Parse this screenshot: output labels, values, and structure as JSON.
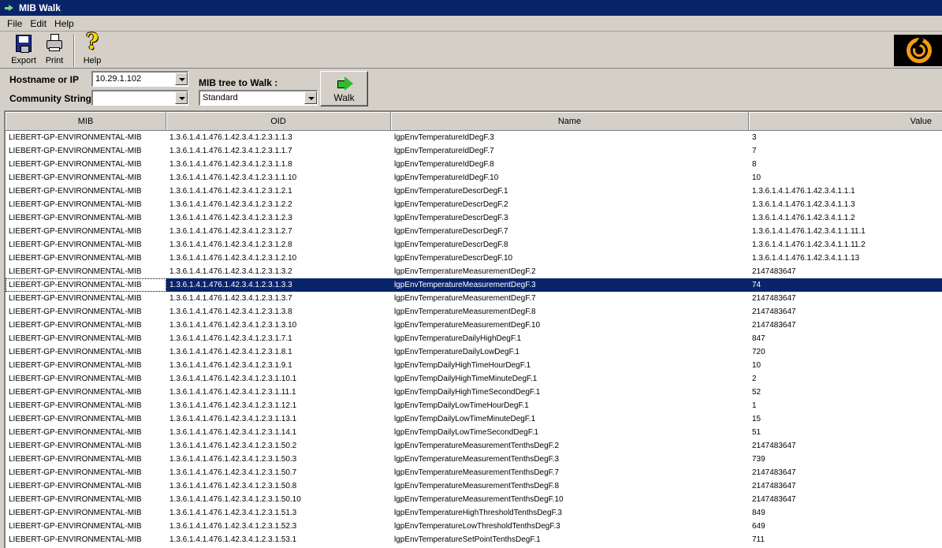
{
  "window": {
    "title": "MIB Walk"
  },
  "menu": [
    "File",
    "Edit",
    "Help"
  ],
  "toolbar": {
    "export_label": "Export",
    "print_label": "Print",
    "help_label": "Help"
  },
  "form": {
    "host_label": "Hostname or IP",
    "host_value": "10.29.1.102",
    "community_label": "Community String",
    "community_value": "",
    "tree_label": "MIB tree to Walk :",
    "tree_value": "Standard",
    "walk_label": "Walk"
  },
  "table": {
    "columns": [
      "MIB",
      "OID",
      "Name",
      "Value"
    ],
    "selected_index": 11,
    "rows": [
      [
        "LIEBERT-GP-ENVIRONMENTAL-MIB",
        "1.3.6.1.4.1.476.1.42.3.4.1.2.3.1.1.3",
        "lgpEnvTemperatureIdDegF.3",
        "3"
      ],
      [
        "LIEBERT-GP-ENVIRONMENTAL-MIB",
        "1.3.6.1.4.1.476.1.42.3.4.1.2.3.1.1.7",
        "lgpEnvTemperatureIdDegF.7",
        "7"
      ],
      [
        "LIEBERT-GP-ENVIRONMENTAL-MIB",
        "1.3.6.1.4.1.476.1.42.3.4.1.2.3.1.1.8",
        "lgpEnvTemperatureIdDegF.8",
        "8"
      ],
      [
        "LIEBERT-GP-ENVIRONMENTAL-MIB",
        "1.3.6.1.4.1.476.1.42.3.4.1.2.3.1.1.10",
        "lgpEnvTemperatureIdDegF.10",
        "10"
      ],
      [
        "LIEBERT-GP-ENVIRONMENTAL-MIB",
        "1.3.6.1.4.1.476.1.42.3.4.1.2.3.1.2.1",
        "lgpEnvTemperatureDescrDegF.1",
        "1.3.6.1.4.1.476.1.42.3.4.1.1.1"
      ],
      [
        "LIEBERT-GP-ENVIRONMENTAL-MIB",
        "1.3.6.1.4.1.476.1.42.3.4.1.2.3.1.2.2",
        "lgpEnvTemperatureDescrDegF.2",
        "1.3.6.1.4.1.476.1.42.3.4.1.1.3"
      ],
      [
        "LIEBERT-GP-ENVIRONMENTAL-MIB",
        "1.3.6.1.4.1.476.1.42.3.4.1.2.3.1.2.3",
        "lgpEnvTemperatureDescrDegF.3",
        "1.3.6.1.4.1.476.1.42.3.4.1.1.2"
      ],
      [
        "LIEBERT-GP-ENVIRONMENTAL-MIB",
        "1.3.6.1.4.1.476.1.42.3.4.1.2.3.1.2.7",
        "lgpEnvTemperatureDescrDegF.7",
        "1.3.6.1.4.1.476.1.42.3.4.1.1.11.1"
      ],
      [
        "LIEBERT-GP-ENVIRONMENTAL-MIB",
        "1.3.6.1.4.1.476.1.42.3.4.1.2.3.1.2.8",
        "lgpEnvTemperatureDescrDegF.8",
        "1.3.6.1.4.1.476.1.42.3.4.1.1.11.2"
      ],
      [
        "LIEBERT-GP-ENVIRONMENTAL-MIB",
        "1.3.6.1.4.1.476.1.42.3.4.1.2.3.1.2.10",
        "lgpEnvTemperatureDescrDegF.10",
        "1.3.6.1.4.1.476.1.42.3.4.1.1.13"
      ],
      [
        "LIEBERT-GP-ENVIRONMENTAL-MIB",
        "1.3.6.1.4.1.476.1.42.3.4.1.2.3.1.3.2",
        "lgpEnvTemperatureMeasurementDegF.2",
        "2147483647"
      ],
      [
        "LIEBERT-GP-ENVIRONMENTAL-MIB",
        "1.3.6.1.4.1.476.1.42.3.4.1.2.3.1.3.3",
        "lgpEnvTemperatureMeasurementDegF.3",
        "74"
      ],
      [
        "LIEBERT-GP-ENVIRONMENTAL-MIB",
        "1.3.6.1.4.1.476.1.42.3.4.1.2.3.1.3.7",
        "lgpEnvTemperatureMeasurementDegF.7",
        "2147483647"
      ],
      [
        "LIEBERT-GP-ENVIRONMENTAL-MIB",
        "1.3.6.1.4.1.476.1.42.3.4.1.2.3.1.3.8",
        "lgpEnvTemperatureMeasurementDegF.8",
        "2147483647"
      ],
      [
        "LIEBERT-GP-ENVIRONMENTAL-MIB",
        "1.3.6.1.4.1.476.1.42.3.4.1.2.3.1.3.10",
        "lgpEnvTemperatureMeasurementDegF.10",
        "2147483647"
      ],
      [
        "LIEBERT-GP-ENVIRONMENTAL-MIB",
        "1.3.6.1.4.1.476.1.42.3.4.1.2.3.1.7.1",
        "lgpEnvTemperatureDailyHighDegF.1",
        "847"
      ],
      [
        "LIEBERT-GP-ENVIRONMENTAL-MIB",
        "1.3.6.1.4.1.476.1.42.3.4.1.2.3.1.8.1",
        "lgpEnvTemperatureDailyLowDegF.1",
        "720"
      ],
      [
        "LIEBERT-GP-ENVIRONMENTAL-MIB",
        "1.3.6.1.4.1.476.1.42.3.4.1.2.3.1.9.1",
        "lgpEnvTempDailyHighTimeHourDegF.1",
        "10"
      ],
      [
        "LIEBERT-GP-ENVIRONMENTAL-MIB",
        "1.3.6.1.4.1.476.1.42.3.4.1.2.3.1.10.1",
        "lgpEnvTempDailyHighTimeMinuteDegF.1",
        "2"
      ],
      [
        "LIEBERT-GP-ENVIRONMENTAL-MIB",
        "1.3.6.1.4.1.476.1.42.3.4.1.2.3.1.11.1",
        "lgpEnvTempDailyHighTimeSecondDegF.1",
        "52"
      ],
      [
        "LIEBERT-GP-ENVIRONMENTAL-MIB",
        "1.3.6.1.4.1.476.1.42.3.4.1.2.3.1.12.1",
        "lgpEnvTempDailyLowTimeHourDegF.1",
        "1"
      ],
      [
        "LIEBERT-GP-ENVIRONMENTAL-MIB",
        "1.3.6.1.4.1.476.1.42.3.4.1.2.3.1.13.1",
        "lgpEnvTempDailyLowTimeMinuteDegF.1",
        "15"
      ],
      [
        "LIEBERT-GP-ENVIRONMENTAL-MIB",
        "1.3.6.1.4.1.476.1.42.3.4.1.2.3.1.14.1",
        "lgpEnvTempDailyLowTimeSecondDegF.1",
        "51"
      ],
      [
        "LIEBERT-GP-ENVIRONMENTAL-MIB",
        "1.3.6.1.4.1.476.1.42.3.4.1.2.3.1.50.2",
        "lgpEnvTemperatureMeasurementTenthsDegF.2",
        "2147483647"
      ],
      [
        "LIEBERT-GP-ENVIRONMENTAL-MIB",
        "1.3.6.1.4.1.476.1.42.3.4.1.2.3.1.50.3",
        "lgpEnvTemperatureMeasurementTenthsDegF.3",
        "739"
      ],
      [
        "LIEBERT-GP-ENVIRONMENTAL-MIB",
        "1.3.6.1.4.1.476.1.42.3.4.1.2.3.1.50.7",
        "lgpEnvTemperatureMeasurementTenthsDegF.7",
        "2147483647"
      ],
      [
        "LIEBERT-GP-ENVIRONMENTAL-MIB",
        "1.3.6.1.4.1.476.1.42.3.4.1.2.3.1.50.8",
        "lgpEnvTemperatureMeasurementTenthsDegF.8",
        "2147483647"
      ],
      [
        "LIEBERT-GP-ENVIRONMENTAL-MIB",
        "1.3.6.1.4.1.476.1.42.3.4.1.2.3.1.50.10",
        "lgpEnvTemperatureMeasurementTenthsDegF.10",
        "2147483647"
      ],
      [
        "LIEBERT-GP-ENVIRONMENTAL-MIB",
        "1.3.6.1.4.1.476.1.42.3.4.1.2.3.1.51.3",
        "lgpEnvTemperatureHighThresholdTenthsDegF.3",
        "849"
      ],
      [
        "LIEBERT-GP-ENVIRONMENTAL-MIB",
        "1.3.6.1.4.1.476.1.42.3.4.1.2.3.1.52.3",
        "lgpEnvTemperatureLowThresholdTenthsDegF.3",
        "649"
      ],
      [
        "LIEBERT-GP-ENVIRONMENTAL-MIB",
        "1.3.6.1.4.1.476.1.42.3.4.1.2.3.1.53.1",
        "lgpEnvTemperatureSetPointTenthsDegF.1",
        "711"
      ]
    ]
  }
}
